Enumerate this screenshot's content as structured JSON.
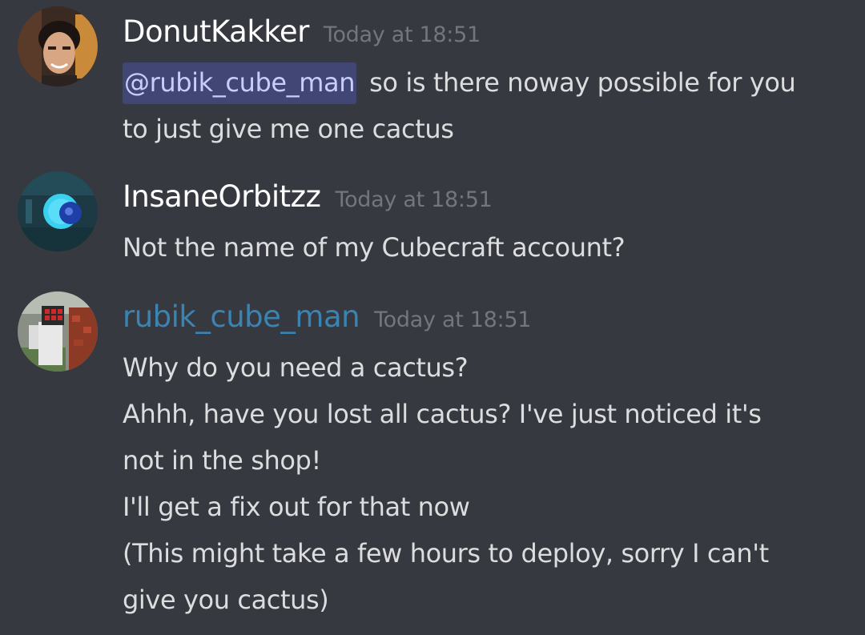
{
  "messages": [
    {
      "author": "DonutKakker",
      "timestamp": "Today at 18:51",
      "mention": "@rubik_cube_man",
      "lines": [
        "so is there noway possible for you",
        "to just give me one cactus"
      ]
    },
    {
      "author": "InsaneOrbitzz",
      "timestamp": "Today at 18:51",
      "lines": [
        "Not the name of my Cubecraft account?"
      ]
    },
    {
      "author": "rubik_cube_man",
      "author_color": "#3a84b3",
      "timestamp": "Today at 18:51",
      "lines": [
        "Why do you need a cactus?",
        "Ahhh, have you lost all cactus? I've just noticed it's",
        "not in the shop!",
        "I'll get a fix out for that now",
        "(This might take a few hours to deploy, sorry I can't",
        "give you cactus)"
      ]
    }
  ],
  "colors": {
    "background": "#36393f",
    "text": "#dcddde",
    "username": "#ffffff",
    "timestamp": "#72767d",
    "mention_bg": "#414675",
    "mention_text": "#c9cdfb"
  },
  "icons": [
    "avatar-donutkakker",
    "avatar-insaneorbitzz",
    "avatar-rubik-cube-man"
  ]
}
